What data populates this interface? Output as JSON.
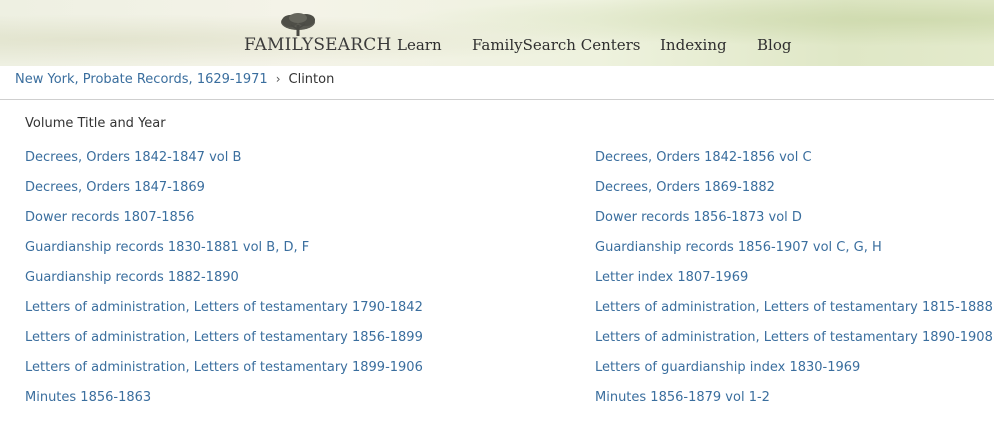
{
  "header": {
    "logo_text": "FAMILYSEARCH",
    "nav": [
      {
        "label": "Learn"
      },
      {
        "label": "FamilySearch Centers"
      },
      {
        "label": "Indexing"
      },
      {
        "label": "Blog"
      }
    ]
  },
  "breadcrumb": {
    "parent": "New York, Probate Records, 1629-1971",
    "separator": "›",
    "current": "Clinton"
  },
  "section_title": "Volume Title and Year",
  "volumes_left": [
    "Decrees, Orders 1842-1847 vol B",
    "Decrees, Orders 1847-1869",
    "Dower records 1807-1856",
    "Guardianship records 1830-1881 vol B, D, F",
    "Guardianship records 1882-1890",
    "Letters of administration, Letters of testamentary 1790-1842",
    "Letters of administration, Letters of testamentary 1856-1899",
    "Letters of administration, Letters of testamentary 1899-1906",
    "Minutes 1856-1863"
  ],
  "volumes_right": [
    "Decrees, Orders 1842-1856 vol C",
    "Decrees, Orders 1869-1882",
    "Dower records 1856-1873 vol D",
    "Guardianship records 1856-1907 vol C, G, H",
    "Letter index 1807-1969",
    "Letters of administration, Letters of testamentary 1815-1888",
    "Letters of administration, Letters of testamentary 1890-1908",
    "Letters of guardianship index 1830-1969",
    "Minutes 1856-1879 vol 1-2"
  ],
  "colors": {
    "link": "#3a6e9e",
    "text": "#333333",
    "header_bg": "#eef0e2"
  }
}
